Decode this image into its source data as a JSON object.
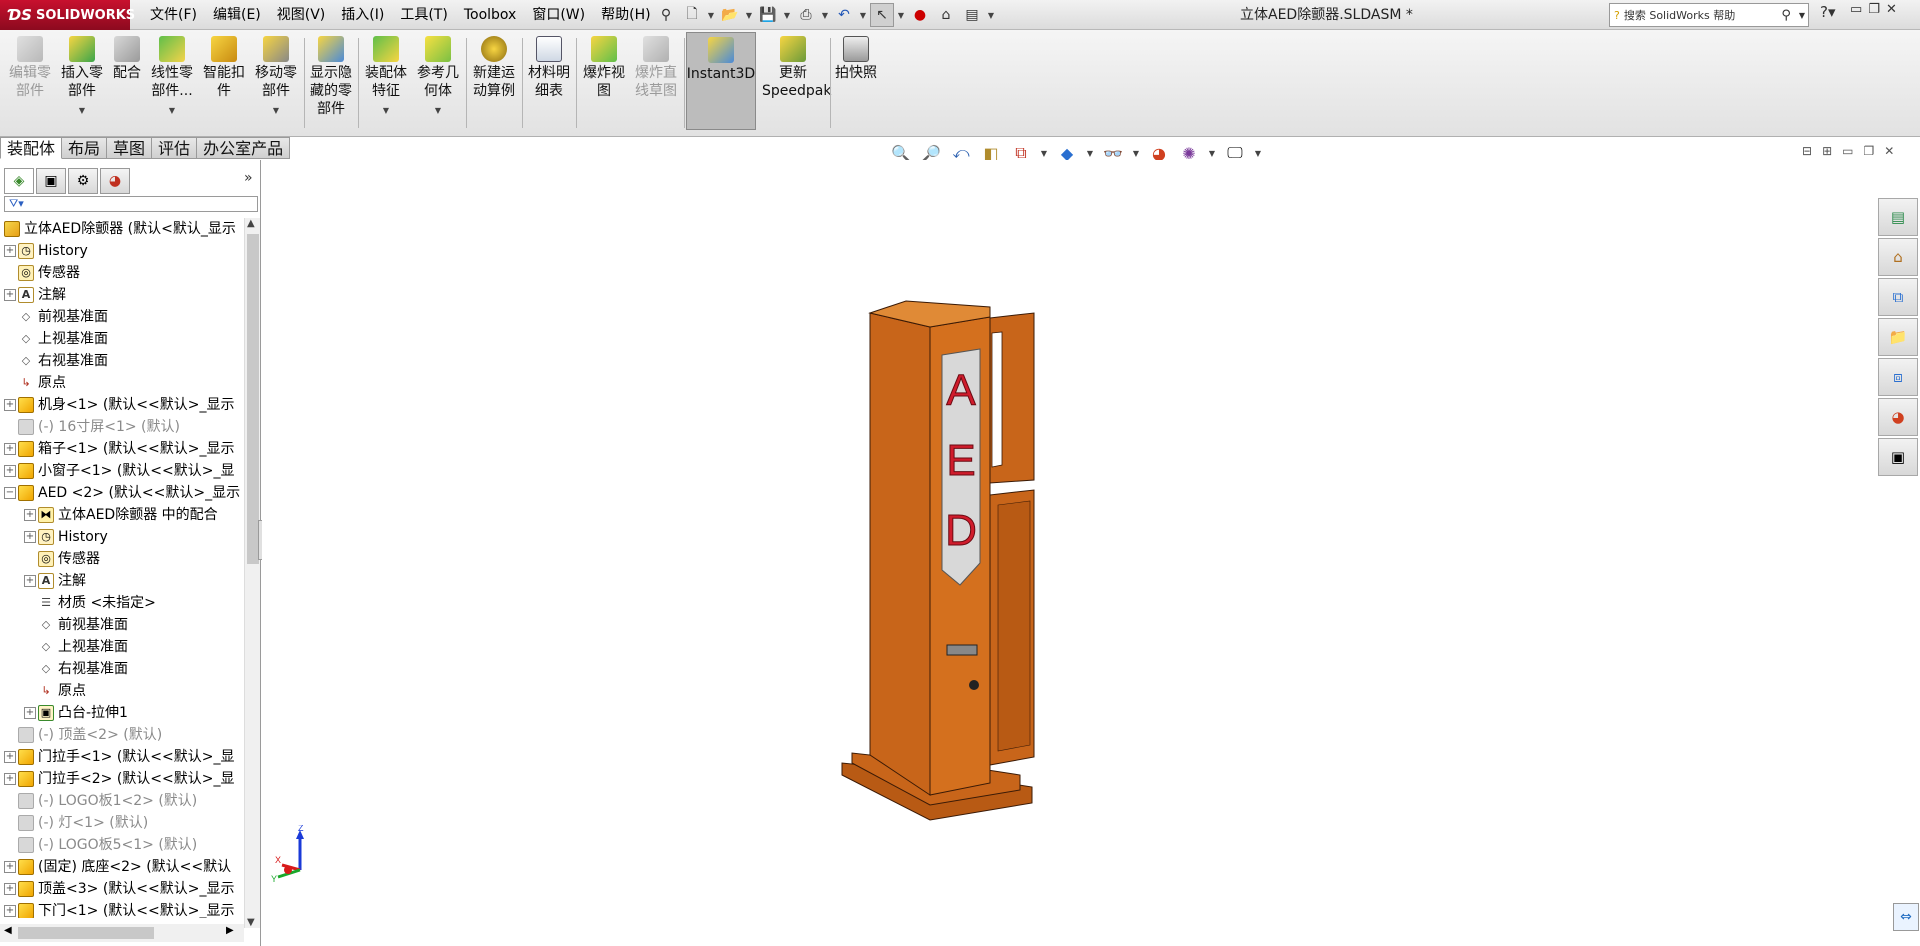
{
  "app": {
    "logo_text": "SOLIDWORKS",
    "doc_title": "立体AED除颤器.SLDASM *",
    "search_placeholder": "搜索 SolidWorks 帮助"
  },
  "menu": [
    "文件(F)",
    "编辑(E)",
    "视图(V)",
    "插入(I)",
    "工具(T)",
    "Toolbox",
    "窗口(W)",
    "帮助(H)"
  ],
  "ribbon": {
    "edit_component": "编辑零部件",
    "insert_component": "插入零部件",
    "mate": "配合",
    "linear_pattern": "线性零部件...",
    "smart_fasteners": "智能扣件",
    "move_component": "移动零部件",
    "show_hidden": "显示隐藏的零部件",
    "assembly_feature": "装配体特征",
    "reference_geometry": "参考几何体",
    "new_motion_study": "新建运动算例",
    "bom": "材料明细表",
    "exploded_view": "爆炸视图",
    "explode_line_sketch": "爆炸直线草图",
    "instant3d": "Instant3D",
    "speedpak": "更新Speedpak",
    "snapshot": "拍快照"
  },
  "command_tabs": [
    "装配体",
    "布局",
    "草图",
    "评估",
    "办公室产品"
  ],
  "tree": {
    "root": "立体AED除颤器 (默认<默认_显示",
    "rows": [
      {
        "label": "History",
        "indent": 0,
        "expander": "+",
        "icon": "history-icon",
        "dim": false
      },
      {
        "label": "传感器",
        "indent": 0,
        "expander": "",
        "icon": "sensor-icon",
        "dim": false
      },
      {
        "label": "注解",
        "indent": 0,
        "expander": "+",
        "icon": "annotation-icon",
        "dim": false
      },
      {
        "label": "前视基准面",
        "indent": 0,
        "expander": "",
        "icon": "plane-icon",
        "dim": false
      },
      {
        "label": "上视基准面",
        "indent": 0,
        "expander": "",
        "icon": "plane-icon",
        "dim": false
      },
      {
        "label": "右视基准面",
        "indent": 0,
        "expander": "",
        "icon": "plane-icon",
        "dim": false
      },
      {
        "label": "原点",
        "indent": 0,
        "expander": "",
        "icon": "origin-icon",
        "dim": false
      },
      {
        "label": "机身<1> (默认<<默认>_显示",
        "indent": 0,
        "expander": "+",
        "icon": "part-icon",
        "dim": false
      },
      {
        "label": "(-) 16寸屏<1> (默认)",
        "indent": 0,
        "expander": "",
        "icon": "part-suppressed-icon",
        "dim": true
      },
      {
        "label": "箱子<1> (默认<<默认>_显示",
        "indent": 0,
        "expander": "+",
        "icon": "part-icon",
        "dim": false
      },
      {
        "label": "小窗子<1> (默认<<默认>_显",
        "indent": 0,
        "expander": "+",
        "icon": "part-icon",
        "dim": false
      },
      {
        "label": "AED <2> (默认<<默认>_显示",
        "indent": 0,
        "expander": "−",
        "icon": "part-icon",
        "dim": false
      },
      {
        "label": "立体AED除颤器 中的配合",
        "indent": 1,
        "expander": "+",
        "icon": "mate-icon",
        "dim": false
      },
      {
        "label": "History",
        "indent": 1,
        "expander": "+",
        "icon": "history-icon",
        "dim": false
      },
      {
        "label": "传感器",
        "indent": 1,
        "expander": "",
        "icon": "sensor-icon",
        "dim": false
      },
      {
        "label": "注解",
        "indent": 1,
        "expander": "+",
        "icon": "annotation-icon",
        "dim": false
      },
      {
        "label": "材质 <未指定>",
        "indent": 1,
        "expander": "",
        "icon": "material-icon",
        "dim": false
      },
      {
        "label": "前视基准面",
        "indent": 1,
        "expander": "",
        "icon": "plane-icon",
        "dim": false
      },
      {
        "label": "上视基准面",
        "indent": 1,
        "expander": "",
        "icon": "plane-icon",
        "dim": false
      },
      {
        "label": "右视基准面",
        "indent": 1,
        "expander": "",
        "icon": "plane-icon",
        "dim": false
      },
      {
        "label": "原点",
        "indent": 1,
        "expander": "",
        "icon": "origin-icon",
        "dim": false
      },
      {
        "label": "凸台-拉伸1",
        "indent": 1,
        "expander": "+",
        "icon": "extrude-icon",
        "dim": false
      },
      {
        "label": "(-) 顶盖<2> (默认)",
        "indent": 0,
        "expander": "",
        "icon": "part-suppressed-icon",
        "dim": true
      },
      {
        "label": "门拉手<1> (默认<<默认>_显",
        "indent": 0,
        "expander": "+",
        "icon": "part-icon",
        "dim": false
      },
      {
        "label": "门拉手<2> (默认<<默认>_显",
        "indent": 0,
        "expander": "+",
        "icon": "part-icon",
        "dim": false
      },
      {
        "label": "(-) LOGO板1<2> (默认)",
        "indent": 0,
        "expander": "",
        "icon": "part-suppressed-icon",
        "dim": true
      },
      {
        "label": "(-) 灯<1> (默认)",
        "indent": 0,
        "expander": "",
        "icon": "part-suppressed-icon",
        "dim": true
      },
      {
        "label": "(-) LOGO板5<1> (默认)",
        "indent": 0,
        "expander": "",
        "icon": "part-suppressed-icon",
        "dim": true
      },
      {
        "label": "(固定) 底座<2> (默认<<默认",
        "indent": 0,
        "expander": "+",
        "icon": "part-icon",
        "dim": false
      },
      {
        "label": "顶盖<3> (默认<<默认>_显示",
        "indent": 0,
        "expander": "+",
        "icon": "part-icon",
        "dim": false
      },
      {
        "label": "下门<1> (默认<<默认>_显示",
        "indent": 0,
        "expander": "+",
        "icon": "part-icon",
        "dim": false
      }
    ]
  },
  "model": {
    "sign_letters": [
      "A",
      "E",
      "D"
    ],
    "body_color": "#c8651a",
    "sign_color": "#d01c2c"
  },
  "triad": {
    "z": "Z",
    "x": "X",
    "y": "Y"
  }
}
